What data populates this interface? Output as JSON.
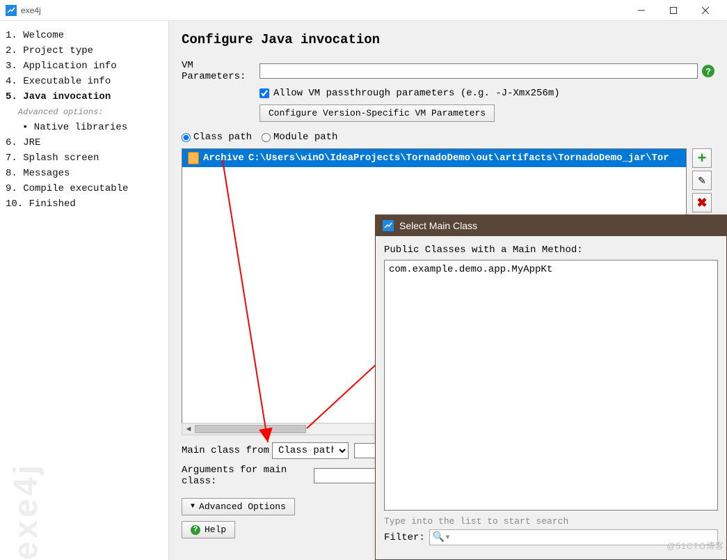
{
  "titlebar": {
    "title": "exe4j"
  },
  "sidebar": {
    "items": [
      "1. Welcome",
      "2. Project type",
      "3. Application info",
      "4. Executable info",
      "5. Java invocation",
      "6. JRE",
      "7. Splash screen",
      "8. Messages",
      "9. Compile executable",
      "10. Finished"
    ],
    "advanced_label": "Advanced options:",
    "native_lib": "• Native libraries",
    "watermark": "exe4j"
  },
  "main": {
    "heading": "Configure Java invocation",
    "vm_params_label": "VM Parameters:",
    "vm_params_value": "",
    "allow_passthrough": "Allow VM passthrough parameters (e.g. -J-Xmx256m)",
    "configure_vm_btn": "Configure Version-Specific VM Parameters",
    "radio_classpath": "Class path",
    "radio_modulepath": "Module path",
    "archive_label": "Archive",
    "archive_path": "C:\\Users\\winO\\IdeaProjects\\TornadoDemo\\out\\artifacts\\TornadoDemo_jar\\Tor",
    "main_class_label": "Main class from",
    "main_class_dropdown": "Class path",
    "main_class_value": "",
    "args_label": "Arguments for main class:",
    "args_value": "",
    "advanced_btn": "Advanced Options",
    "help_btn": "Help"
  },
  "dialog": {
    "title": "Select Main Class",
    "subtitle": "Public Classes with a Main Method:",
    "entry": "com.example.demo.app.MyAppKt",
    "hint": "Type into the list to start search",
    "filter_label": "Filter:"
  },
  "corner_wm": "@51CTO博客"
}
